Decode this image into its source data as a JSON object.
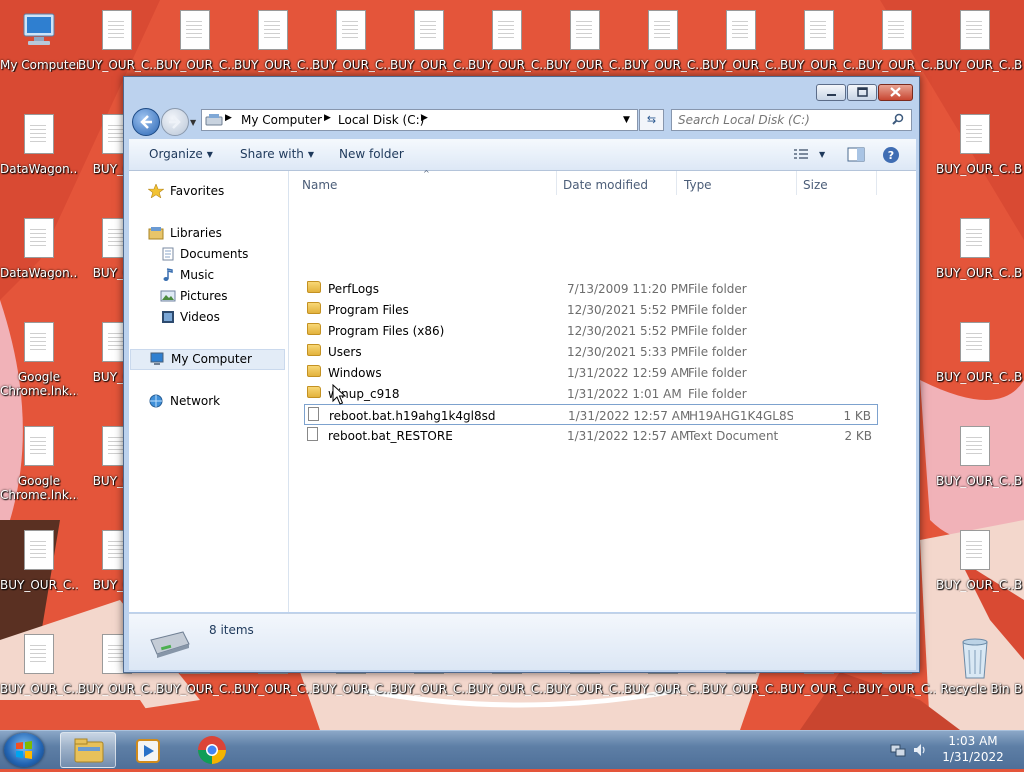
{
  "desktop": {
    "icons": [
      {
        "label": "My Computer"
      },
      {
        "label": "BUY_OUR_C..."
      },
      {
        "label": "DataWagon..."
      },
      {
        "label": "Google\nChrome.lnk..."
      },
      {
        "label": "Recycle Bin"
      },
      {
        "label": "BUY_OU"
      },
      {
        "label": "B"
      }
    ]
  },
  "window": {
    "address": {
      "crumbs": [
        "My Computer",
        "Local Disk (C:)"
      ]
    },
    "search": {
      "placeholder": "Search Local Disk (C:)"
    },
    "commands": {
      "organize": "Organize",
      "share_with": "Share with",
      "new_folder": "New folder"
    },
    "nav": {
      "favorites": "Favorites",
      "libraries": "Libraries",
      "documents": "Documents",
      "music": "Music",
      "pictures": "Pictures",
      "videos": "Videos",
      "my_computer": "My Computer",
      "network": "Network"
    },
    "columns": {
      "name": "Name",
      "date": "Date modified",
      "type": "Type",
      "size": "Size"
    },
    "files": [
      {
        "name": "PerfLogs",
        "date": "7/13/2009 11:20 PM",
        "type": "File folder",
        "size": "",
        "kind": "folder"
      },
      {
        "name": "Program Files",
        "date": "12/30/2021 5:52 PM",
        "type": "File folder",
        "size": "",
        "kind": "folder"
      },
      {
        "name": "Program Files (x86)",
        "date": "12/30/2021 5:52 PM",
        "type": "File folder",
        "size": "",
        "kind": "folder"
      },
      {
        "name": "Users",
        "date": "12/30/2021 5:33 PM",
        "type": "File folder",
        "size": "",
        "kind": "folder"
      },
      {
        "name": "Windows",
        "date": "1/31/2022 12:59 AM",
        "type": "File folder",
        "size": "",
        "kind": "folder"
      },
      {
        "name": "winup_c918",
        "date": "1/31/2022 1:01 AM",
        "type": "File folder",
        "size": "",
        "kind": "folder"
      },
      {
        "name": "reboot.bat.h19ahg1k4gl8sd",
        "date": "1/31/2022 12:57 AM",
        "type": "H19AHG1K4GL8S...",
        "size": "1 KB",
        "kind": "file"
      },
      {
        "name": "reboot.bat_RESTORE",
        "date": "1/31/2022 12:57 AM",
        "type": "Text Document",
        "size": "2 KB",
        "kind": "file"
      }
    ],
    "details": {
      "item_count": "8 items"
    }
  },
  "taskbar": {
    "time": "1:03 AM",
    "date": "1/31/2022"
  },
  "colors": {
    "wallpaper_red": "#e4553a",
    "window_frame": "#bcd2ee",
    "taskbar": "#5e7fa6",
    "link_text": "#1e395b"
  }
}
